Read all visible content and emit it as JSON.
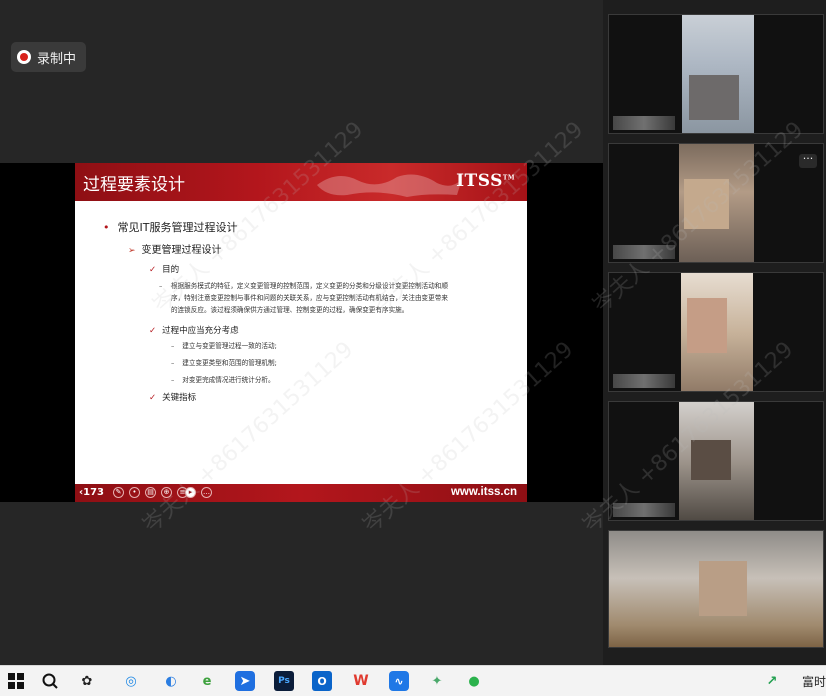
{
  "recording": {
    "label": "录制中"
  },
  "slide": {
    "title": "过程要素设计",
    "brand": "ITSS",
    "brand_tm": "TM",
    "heading": "常见IT服务管理过程设计",
    "subheading": "变更管理过程设计",
    "section1": "目的",
    "para1_line1": "根据服务模式的特征，定义变更管理的控制范围，定义变更的分类和分级设计变更控制活动和顺",
    "para1_line2": "序，特别注意变更控制与事件和问题的关联关系，应与变更控制活动有机结合，关注由变更带来",
    "para1_line3": "的连锁反应。该过程须确保供方通过管理、控制变更的过程，确保变更有序实施。",
    "section2": "过程中应当充分考虑",
    "sub1": "建立与变更管理过程一致的活动;",
    "sub2": "建立变更类型和范围的管理机制;",
    "sub3": "对变更完成情况进行统计分析。",
    "section3": "关键指标",
    "page_number": "173",
    "website": "www.itss.cn"
  },
  "watermark": {
    "text": "岑夫人 +8617631531129"
  },
  "taskbar": {
    "tray_text": "富时",
    "icons": [
      "windows-start-icon",
      "search-icon",
      "app-icon",
      "edge-icon",
      "browser-icon",
      "ie-icon",
      "feishu-icon",
      "photoshop-icon",
      "outlook-icon",
      "wps-icon",
      "meeting-app-icon",
      "wechat-icon",
      "image-app-icon"
    ]
  },
  "colors": {
    "slide_red": "#b3161c",
    "taskbar_bg": "#f3f3f3",
    "stage_bg": "#262626"
  }
}
